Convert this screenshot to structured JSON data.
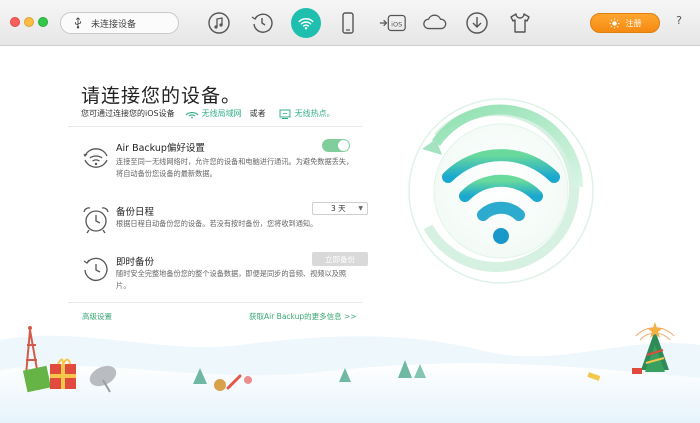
{
  "toolbar": {
    "device_select": "未连接设备",
    "icons": [
      "music-icon",
      "history-icon",
      "wifi-icon",
      "phone-icon",
      "ios-transfer-icon",
      "cloud-icon",
      "download-icon",
      "tshirt-icon"
    ],
    "ios_label": "iOS",
    "register_label": "注册",
    "help_label": "?",
    "accent_color": "#1fbfb0",
    "register_color": "#f58a12"
  },
  "main": {
    "title": "请连接您的设备。",
    "subtitle_prefix": "您可通过连接您的iOS设备",
    "wifi_link": "无线局域网",
    "or_text": "或者",
    "hotspot_link": "无线热点。",
    "settings": [
      {
        "title": "Air Backup偏好设置",
        "desc": "连接至同一无线网络时，允许您的设备和电脑进行通讯。为避免数据丢失，将自动备份您设备的最新数据。",
        "toggle_on": true
      },
      {
        "title": "备份日程",
        "desc": "根据日程自动备份您的设备。若没有按时备份，您将收到通知。",
        "schedule_value": "3 天"
      },
      {
        "title": "即时备份",
        "desc": "随时安全完整地备份您的整个设备数据，即便是同步的音频、视频以及照片。",
        "button_label": "立即备份"
      }
    ],
    "advanced_link": "高级设置",
    "more_info_link": "获取Air Backup的更多信息 >>"
  }
}
